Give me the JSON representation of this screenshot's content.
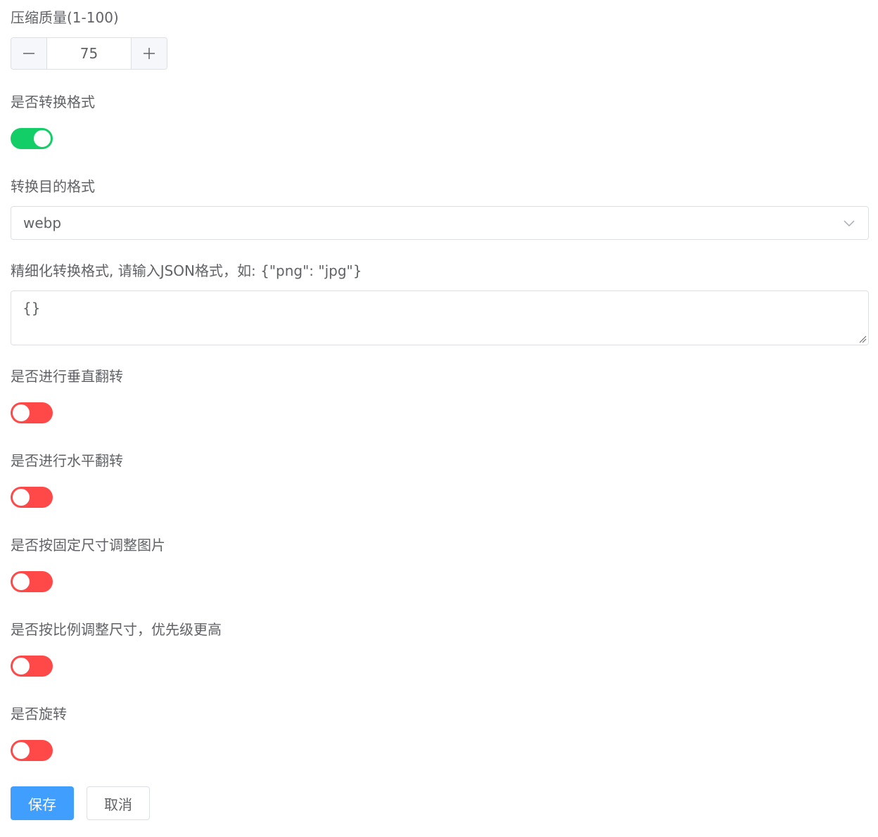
{
  "compress_quality": {
    "label": "压缩质量(1-100)",
    "value": "75",
    "minus_icon": "minus-icon",
    "plus_icon": "plus-icon"
  },
  "convert_format": {
    "label": "是否转换格式",
    "enabled": true
  },
  "target_format": {
    "label": "转换目的格式",
    "selected": "webp",
    "icon": "chevron-down-icon"
  },
  "fine_format": {
    "label": "精细化转换格式, 请输入JSON格式，如: {\"png\": \"jpg\"}",
    "value": "{}"
  },
  "vertical_flip": {
    "label": "是否进行垂直翻转",
    "enabled": false
  },
  "horizontal_flip": {
    "label": "是否进行水平翻转",
    "enabled": false
  },
  "fixed_resize": {
    "label": "是否按固定尺寸调整图片",
    "enabled": false
  },
  "ratio_resize": {
    "label": "是否按比例调整尺寸，优先级更高",
    "enabled": false
  },
  "rotate": {
    "label": "是否旋转",
    "enabled": false
  },
  "actions": {
    "save_label": "保存",
    "cancel_label": "取消"
  },
  "colors": {
    "switch_on": "#13ce66",
    "switch_off": "#ff4949",
    "primary": "#409eff",
    "text": "#606266",
    "border": "#dcdfe6"
  }
}
